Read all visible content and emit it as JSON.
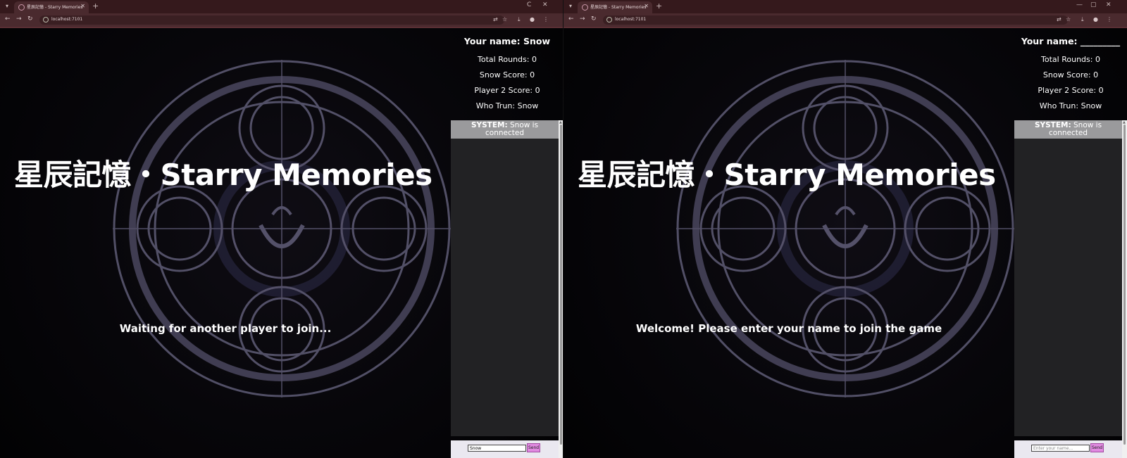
{
  "browser": {
    "tab_title": "星辰記憶 - Starry Memories",
    "url": "localhost:7101"
  },
  "game": {
    "title": "星辰記憶・Starry Memories"
  },
  "left": {
    "your_name": "Your name: Snow",
    "total_rounds": "Total Rounds: 0",
    "snow_score": "Snow Score: 0",
    "player2_score": "Player 2 Score: 0",
    "who_turn": "Who Trun: Snow",
    "system_label": "SYSTEM:",
    "system_text": "Snow is connected",
    "status_message": "Waiting for another player to join...",
    "input_value": "Snow",
    "send_label": "Send"
  },
  "right": {
    "your_name": "Your name: _________",
    "total_rounds": "Total Rounds: 0",
    "snow_score": "Snow Score: 0",
    "player2_score": "Player 2 Score: 0",
    "who_turn": "Who Trun: Snow",
    "system_label": "SYSTEM:",
    "system_text": "Snow is connected",
    "status_message": "Welcome! Please enter your name to join the game",
    "input_placeholder": "Enter your name...",
    "send_label": "Send"
  },
  "colors": {
    "tabbar": "#35191c",
    "toolbar": "#4a2a2e",
    "chat_bg": "#222224",
    "system_bg": "#9a9a9c",
    "send_button": "#e08ae0"
  }
}
